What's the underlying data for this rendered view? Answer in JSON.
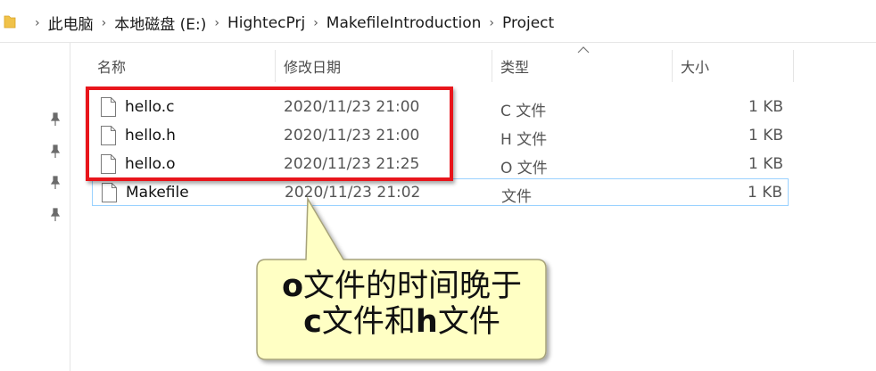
{
  "breadcrumb": [
    "此电脑",
    "本地磁盘 (E:)",
    "HightecPrj",
    "MakefileIntroduction",
    "Project"
  ],
  "columns": {
    "name": "名称",
    "date": "修改日期",
    "type": "类型",
    "size": "大小"
  },
  "files": [
    {
      "name": "hello.c",
      "date": "2020/11/23 21:00",
      "type": "C 文件",
      "size": "1 KB"
    },
    {
      "name": "hello.h",
      "date": "2020/11/23 21:00",
      "type": "H 文件",
      "size": "1 KB"
    },
    {
      "name": "hello.o",
      "date": "2020/11/23 21:25",
      "type": "O 文件",
      "size": "1 KB"
    },
    {
      "name": "Makefile",
      "date": "2020/11/23 21:02",
      "type": "文件",
      "size": "1 KB"
    }
  ],
  "callout": {
    "line1_bold": "o",
    "line1_rest": "文件的时间晚于",
    "line2_bold1": "c",
    "line2_mid": "文件和",
    "line2_bold2": "h",
    "line2_rest": "文件"
  },
  "colors": {
    "highlight": "#e8151b",
    "callout_fill": "#ffffc4",
    "callout_border": "#a6a27a",
    "selection_border": "#99d1ff"
  }
}
